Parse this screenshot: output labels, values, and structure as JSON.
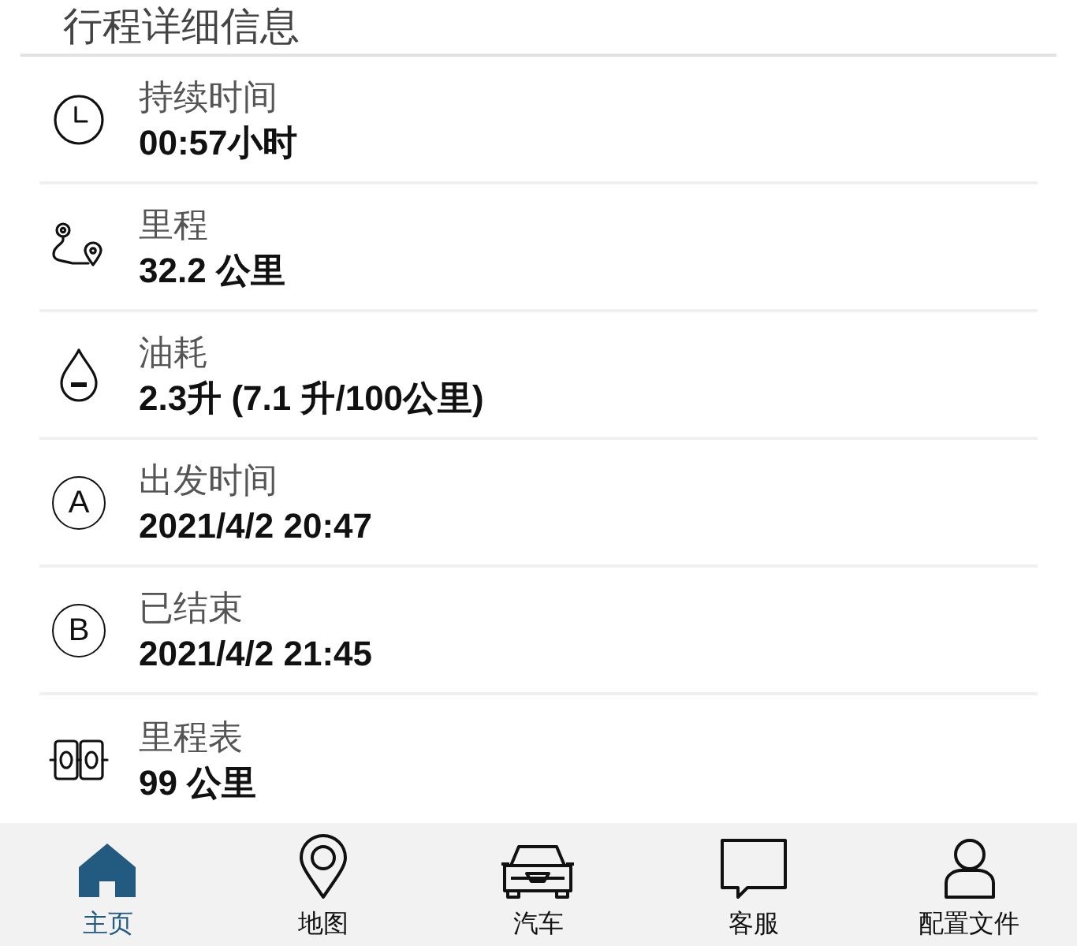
{
  "section_title": "行程详细信息",
  "details": [
    {
      "kind": "clock",
      "label": "持续时间",
      "value": "00:57小时"
    },
    {
      "kind": "route",
      "label": "里程",
      "value": "32.2 公里"
    },
    {
      "kind": "drop",
      "label": "油耗",
      "value": "2.3升 (7.1 升/100公里)"
    },
    {
      "kind": "letter",
      "letter": "A",
      "label": "出发时间",
      "value": "2021/4/2 20:47"
    },
    {
      "kind": "letter",
      "letter": "B",
      "label": "已结束",
      "value": "2021/4/2 21:45"
    },
    {
      "kind": "odometer",
      "label": "里程表",
      "value": "99 公里"
    }
  ],
  "nav": [
    {
      "kind": "home",
      "label": "主页",
      "selected": true
    },
    {
      "kind": "map",
      "label": "地图",
      "selected": false
    },
    {
      "kind": "car",
      "label": "汽车",
      "selected": false
    },
    {
      "kind": "chat",
      "label": "客服",
      "selected": false
    },
    {
      "kind": "profile",
      "label": "配置文件",
      "selected": false
    }
  ]
}
